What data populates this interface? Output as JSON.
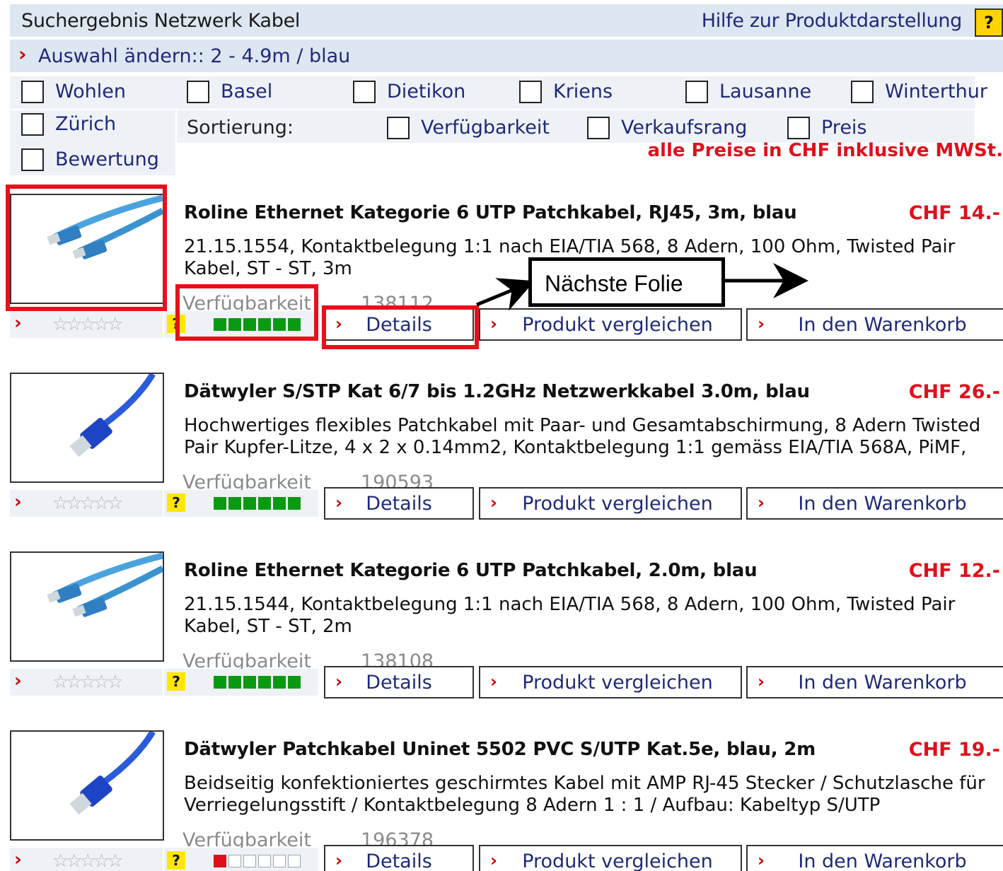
{
  "header": {
    "title": "Suchergebnis Netzwerk Kabel",
    "help_link": "Hilfe zur Produktdarstellung",
    "help_icon": "?"
  },
  "selection": {
    "arrow": "›",
    "text": "Auswahl ändern:: 2 - 4.9m / blau"
  },
  "filters": {
    "locations": [
      "Wohlen",
      "Basel",
      "Dietikon",
      "Kriens",
      "Lausanne",
      "Winterthur",
      "Zürich"
    ],
    "sort_label": "Sortierung:",
    "sort_options": [
      "Verfügbarkeit",
      "Verkaufsrang",
      "Preis",
      "Bewertung"
    ]
  },
  "price_note": "alle Preise in CHF inklusive MWSt.",
  "labels": {
    "availability": "Verfügbarkeit",
    "details": "Details",
    "compare": "Produkt vergleichen",
    "cart": "In den Warenkorb",
    "arrow": "›",
    "stars": "☆☆☆☆☆",
    "question": "?"
  },
  "products": [
    {
      "name": "Roline Ethernet Kategorie 6 UTP Patchkabel, RJ45, 3m, blau",
      "price": "CHF 14.-",
      "description": "21.15.1554, Kontaktbelegung 1:1 nach EIA/TIA 568, 8 Adern, 100 Ohm, Twisted Pair Kabel, ST - ST, 3m",
      "article_no": "138112",
      "availability_level": 6,
      "availability_color": "#0a9a12",
      "image_icon": "patch-cable-double"
    },
    {
      "name": "Dätwyler S/STP Kat 6/7 bis 1.2GHz Netzwerkkabel 3.0m, blau",
      "price": "CHF 26.-",
      "description": "Hochwertiges flexibles Patchkabel mit Paar- und Gesamtabschirmung, 8 Adern Twisted Pair Kupfer-Litze, 4 x 2 x 0.14mm2, Kontaktbelegung 1:1 gemäss EIA/TIA 568A, PiMF,",
      "article_no": "190593",
      "availability_level": 6,
      "availability_color": "#0a9a12",
      "image_icon": "patch-cable-single"
    },
    {
      "name": "Roline Ethernet Kategorie 6 UTP Patchkabel, 2.0m, blau",
      "price": "CHF 12.-",
      "description": "21.15.1544, Kontaktbelegung 1:1 nach EIA/TIA 568, 8 Adern, 100 Ohm, Twisted Pair Kabel, ST - ST, 2m",
      "article_no": "138108",
      "availability_level": 6,
      "availability_color": "#0a9a12",
      "image_icon": "patch-cable-double"
    },
    {
      "name": "Dätwyler Patchkabel Uninet 5502 PVC S/UTP Kat.5e, blau, 2m",
      "price": "CHF 19.-",
      "description": "Beidseitig konfektioniertes geschirmtes Kabel mit AMP RJ-45 Stecker / Schutzlasche für Verriegelungsstift / Kontaktbelegung 8 Adern 1 : 1 / Aufbau: Kabeltyp S/UTP",
      "article_no": "196378",
      "availability_level": 1,
      "availability_color": "#e0101b",
      "image_icon": "patch-cable-single"
    }
  ],
  "annotation": {
    "callout_text": "Nächste Folie",
    "highlight_color": "#e8101b"
  }
}
